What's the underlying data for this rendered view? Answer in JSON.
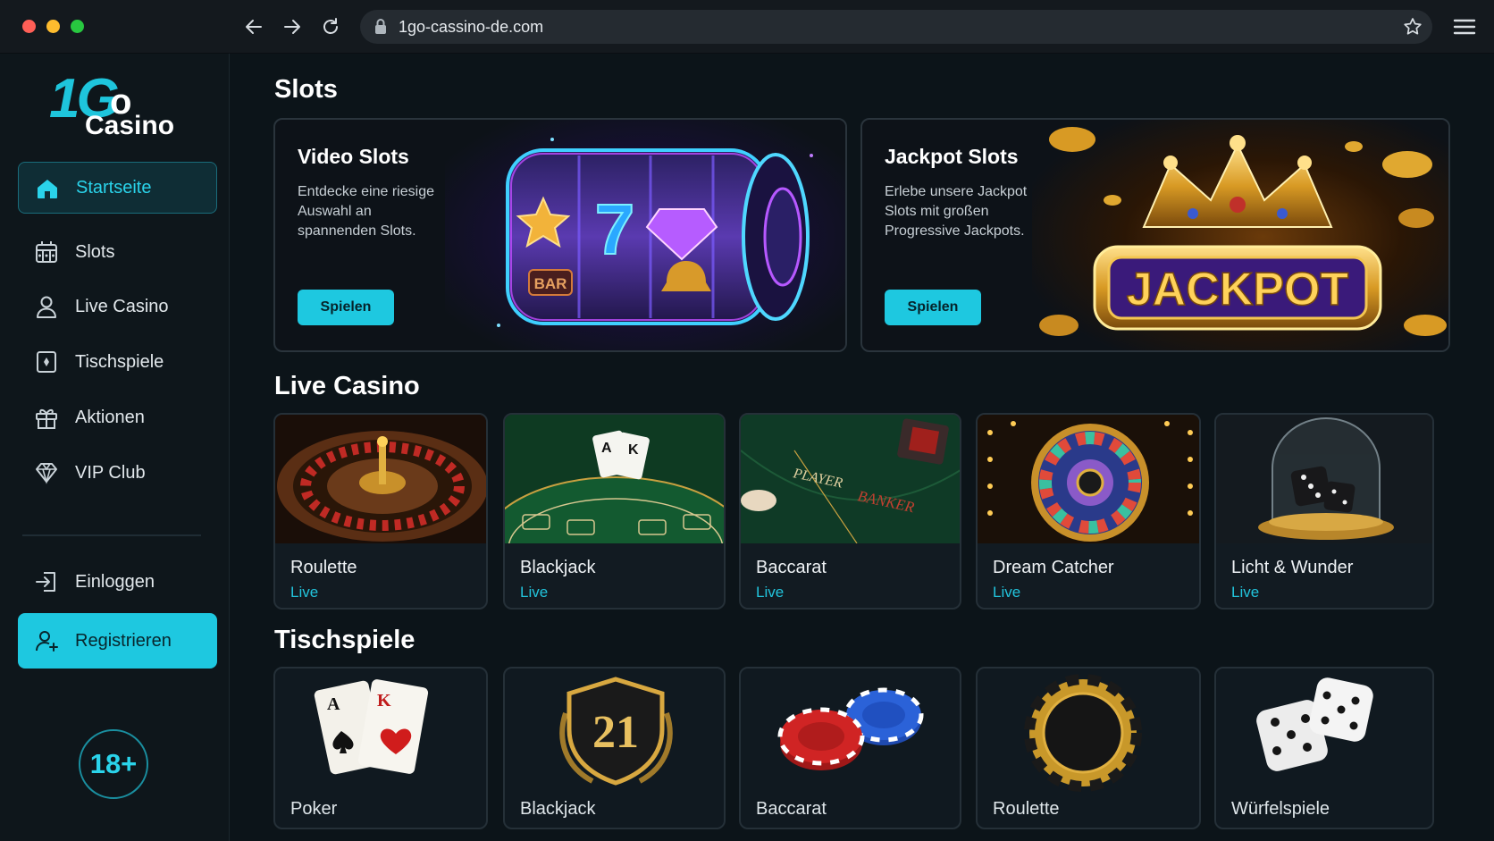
{
  "browser": {
    "url": "1go-cassino-de.com",
    "traffic_lights": [
      "#ff5f57",
      "#febc2e",
      "#28c840"
    ]
  },
  "sidebar": {
    "logo": {
      "number_part": "1G",
      "o_part": "o",
      "word": "Casino"
    },
    "items": [
      {
        "label": "Startseite",
        "icon": "home-icon",
        "active": true
      },
      {
        "label": "Slots",
        "icon": "slot-machine-icon"
      },
      {
        "label": "Live Casino",
        "icon": "user-icon"
      },
      {
        "label": "Tischspiele",
        "icon": "card-icon"
      },
      {
        "label": "Aktionen",
        "icon": "gift-icon"
      },
      {
        "label": "VIP Club",
        "icon": "diamond-icon"
      }
    ],
    "login_label": "Einloggen",
    "register_label": "Registrieren",
    "age_badge": "18+"
  },
  "sections": {
    "slots": {
      "title": "Slots",
      "promos": [
        {
          "title": "Video Slots",
          "description": "Entdecke eine riesige Auswahl an spannenden Slots.",
          "button": "Spielen"
        },
        {
          "title": "Jackpot Slots",
          "description": "Erlebe unsere Jackpot Slots mit großen Progressive Jackpots.",
          "button": "Spielen",
          "banner_text": "JACKPOT"
        }
      ]
    },
    "live_casino": {
      "title": "Live Casino",
      "games": [
        {
          "name": "Roulette",
          "tag": "Live"
        },
        {
          "name": "Blackjack",
          "tag": "Live"
        },
        {
          "name": "Baccarat",
          "tag": "Live"
        },
        {
          "name": "Dream Catcher",
          "tag": "Live"
        },
        {
          "name": "Licht & Wunder",
          "tag": "Live"
        }
      ]
    },
    "table_games": {
      "title": "Tischspiele",
      "games": [
        {
          "name": "Poker"
        },
        {
          "name": "Blackjack",
          "badge": "21"
        },
        {
          "name": "Baccarat"
        },
        {
          "name": "Roulette"
        },
        {
          "name": "Würfelspiele"
        }
      ]
    }
  },
  "art_text": {
    "slot_symbol": "7",
    "bar": "BAR",
    "player": "PLAYER",
    "banker": "BANKER",
    "card_a": "A",
    "card_k": "K"
  },
  "colors": {
    "accent": "#1ec8e0",
    "background": "#0c1419",
    "sidebar": "#0e161b"
  }
}
